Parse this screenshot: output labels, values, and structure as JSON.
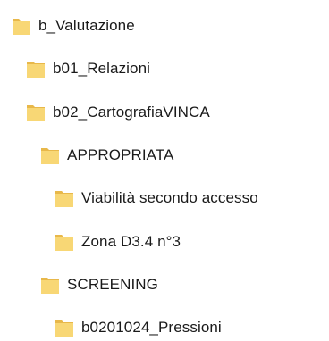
{
  "icons": {
    "folder": "folder-icon",
    "folder_color": "#F8D775",
    "folder_tab_color": "#E8B84A"
  },
  "tree": {
    "items": [
      {
        "label": "b_Valutazione"
      },
      {
        "label": "b01_Relazioni"
      },
      {
        "label": "b02_CartografiaVINCA"
      },
      {
        "label": "APPROPRIATA"
      },
      {
        "label": "Viabilità secondo accesso"
      },
      {
        "label": "Zona D3.4 n°3"
      },
      {
        "label": "SCREENING"
      },
      {
        "label": "b0201024_Pressioni"
      }
    ]
  }
}
